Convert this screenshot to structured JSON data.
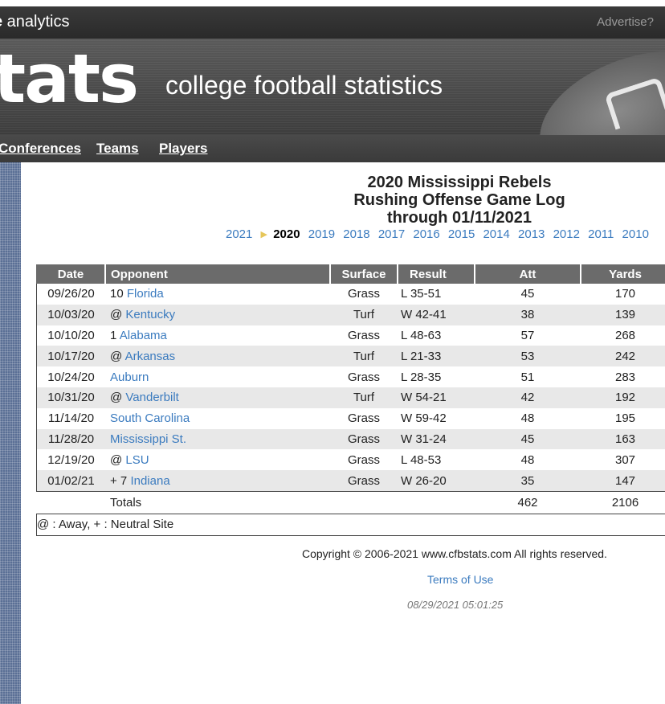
{
  "topbar": {
    "brand_bold": "e",
    "brand_text": " analytics",
    "advertise": "Advertise?"
  },
  "banner": {
    "logo": "tats",
    "tagline": "college football statistics"
  },
  "nav": {
    "items": [
      {
        "label": "Conferences"
      },
      {
        "label": "Teams"
      },
      {
        "label": "Players"
      }
    ]
  },
  "title": {
    "line1": "2020 Mississippi Rebels",
    "line2": "Rushing Offense Game Log",
    "line3": "through 01/11/2021"
  },
  "years": {
    "before": [
      "2021"
    ],
    "current": "2020",
    "after": [
      "2019",
      "2018",
      "2017",
      "2016",
      "2015",
      "2014",
      "2013",
      "2012",
      "2011",
      "2010"
    ]
  },
  "table": {
    "headers": [
      "Date",
      "Opponent",
      "Surface",
      "Result",
      "Att",
      "Yards"
    ],
    "rows": [
      {
        "date": "09/26/20",
        "prefix": "10",
        "opponent": "Florida",
        "surface": "Grass",
        "result": "L 35-51",
        "att": "45",
        "yards": "170"
      },
      {
        "date": "10/03/20",
        "prefix": "@",
        "opponent": "Kentucky",
        "surface": "Turf",
        "result": "W 42-41",
        "att": "38",
        "yards": "139"
      },
      {
        "date": "10/10/20",
        "prefix": "1",
        "opponent": "Alabama",
        "surface": "Grass",
        "result": "L 48-63",
        "att": "57",
        "yards": "268"
      },
      {
        "date": "10/17/20",
        "prefix": "@",
        "opponent": "Arkansas",
        "surface": "Turf",
        "result": "L 21-33",
        "att": "53",
        "yards": "242"
      },
      {
        "date": "10/24/20",
        "prefix": "",
        "opponent": "Auburn",
        "surface": "Grass",
        "result": "L 28-35",
        "att": "51",
        "yards": "283"
      },
      {
        "date": "10/31/20",
        "prefix": "@",
        "opponent": "Vanderbilt",
        "surface": "Turf",
        "result": "W 54-21",
        "att": "42",
        "yards": "192"
      },
      {
        "date": "11/14/20",
        "prefix": "",
        "opponent": "South Carolina",
        "surface": "Grass",
        "result": "W 59-42",
        "att": "48",
        "yards": "195"
      },
      {
        "date": "11/28/20",
        "prefix": "",
        "opponent": "Mississippi St.",
        "surface": "Grass",
        "result": "W 31-24",
        "att": "45",
        "yards": "163"
      },
      {
        "date": "12/19/20",
        "prefix": "@",
        "opponent": "LSU",
        "surface": "Grass",
        "result": "L 48-53",
        "att": "48",
        "yards": "307"
      },
      {
        "date": "01/02/21",
        "prefix": "+ 7",
        "opponent": "Indiana",
        "surface": "Grass",
        "result": "W 26-20",
        "att": "35",
        "yards": "147"
      }
    ],
    "totals": {
      "label": "Totals",
      "att": "462",
      "yards": "2106"
    },
    "legend": "@ : Away, + : Neutral Site"
  },
  "footer": {
    "copyright": "Copyright © 2006-2021 www.cfbstats.com All rights reserved.",
    "terms": "Terms of Use",
    "timestamp": "08/29/2021 05:01:25"
  },
  "colors": {
    "link": "#3b7bbf",
    "header_bg": "#6b6b6b",
    "row_alt": "#e8e8e8",
    "sidebar": "#5a6f95",
    "arrow": "#e6c65a"
  }
}
